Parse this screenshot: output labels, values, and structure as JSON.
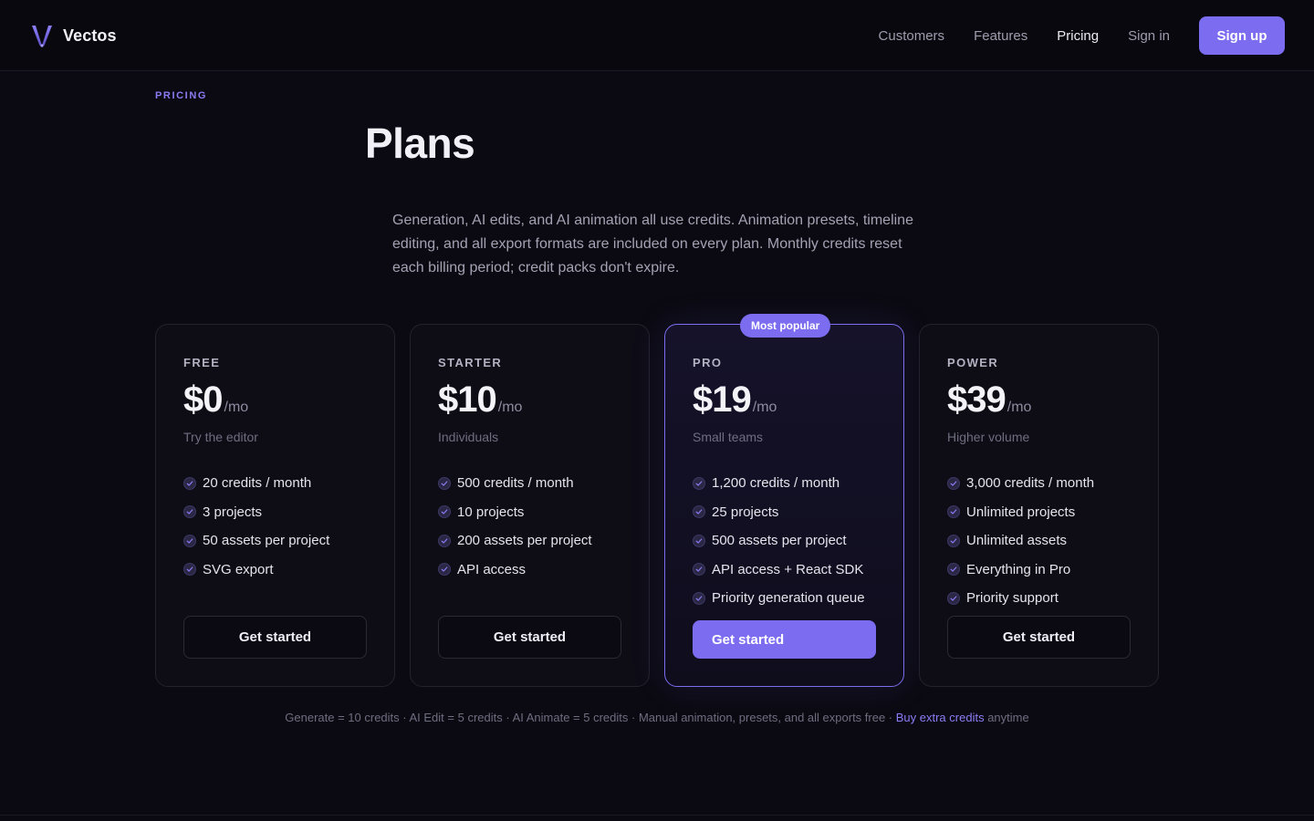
{
  "header": {
    "brand": "Vectos",
    "nav": [
      "Customers",
      "Features",
      "Pricing",
      "Sign in"
    ],
    "active_nav": "Pricing",
    "signup_label": "Sign up"
  },
  "hero": {
    "eyebrow": "PRICING",
    "title": "Plans",
    "intro": "Generation, AI edits, and AI animation all use credits. Animation presets, timeline editing, and all export formats are included on every plan. Monthly credits reset each billing period; credit packs don't expire."
  },
  "plans": [
    {
      "name": "FREE",
      "price": "$0",
      "period": "/mo",
      "tagline": "Try the editor",
      "features": [
        "20 credits / month",
        "3 projects",
        "50 assets per project",
        "SVG export"
      ],
      "cta": "Get started"
    },
    {
      "name": "STARTER",
      "price": "$10",
      "period": "/mo",
      "tagline": "Individuals",
      "features": [
        "500 credits / month",
        "10 projects",
        "200 assets per project",
        "API access"
      ],
      "cta": "Get started"
    },
    {
      "name": "PRO",
      "price": "$19",
      "period": "/mo",
      "tagline": "Small teams",
      "badge": "Most popular",
      "features": [
        "1,200 credits / month",
        "25 projects",
        "500 assets per project",
        "API access + React SDK",
        "Priority generation queue"
      ],
      "cta": "Get started"
    },
    {
      "name": "POWER",
      "price": "$39",
      "period": "/mo",
      "tagline": "Higher volume",
      "features": [
        "3,000 credits / month",
        "Unlimited projects",
        "Unlimited assets",
        "Everything in Pro",
        "Priority support"
      ],
      "cta": "Get started"
    }
  ],
  "footnote": {
    "text": "Generate = 10 credits · AI Edit = 5 credits · AI Animate = 5 credits · Manual animation, presets, and all exports free · ",
    "link": "Buy extra credits",
    "suffix": " anytime"
  },
  "colors": {
    "accent": "#7b6cf0",
    "background": "#0b0a12"
  },
  "icons": {
    "logo": "vectos-logo-icon",
    "feature": "check-circle-icon"
  }
}
